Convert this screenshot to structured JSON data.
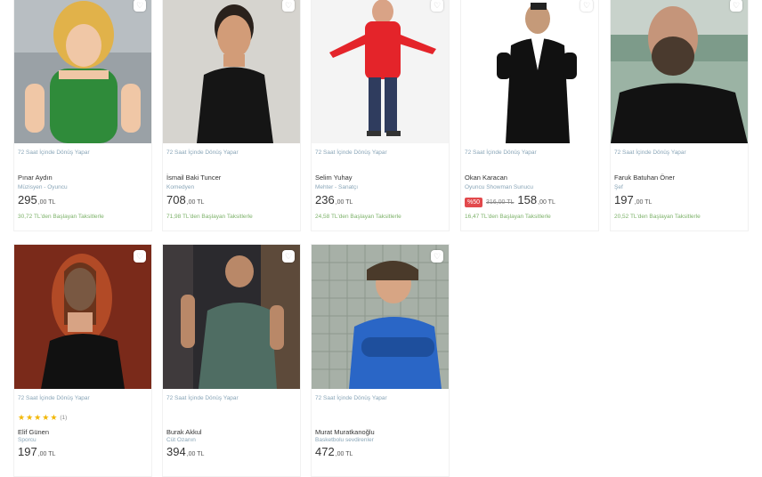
{
  "cards": [
    {
      "delivery": "72 Saat İçinde Dönüş Yapar",
      "name": "Pınar Aydın",
      "role": "Müzisyen - Oyuncu",
      "price": "295",
      "price_dec": ",00 TL",
      "install": "30,72 TL'den Başlayan Taksitlerle"
    },
    {
      "delivery": "72 Saat İçinde Dönüş Yapar",
      "name": "İsmail Baki Tuncer",
      "role": "Komedyen",
      "price": "708",
      "price_dec": ",00 TL",
      "install": "71,98 TL'den Başlayan Taksitlerle"
    },
    {
      "delivery": "72 Saat İçinde Dönüş Yapar",
      "name": "Selim Yuhay",
      "role": "Mehter - Sanatçı",
      "price": "236",
      "price_dec": ",00 TL",
      "install": "24,58 TL'den Başlayan Taksitlerle"
    },
    {
      "delivery": "72 Saat İçinde Dönüş Yapar",
      "name": "Okan Karacan",
      "role": "Oyuncu Showman Sunucu",
      "discount": "%50",
      "old_price": "316,00 TL",
      "price": "158",
      "price_dec": ",00 TL",
      "install": "16,47 TL'den Başlayan Taksitlerle"
    },
    {
      "delivery": "72 Saat İçinde Dönüş Yapar",
      "name": "Faruk Batuhan Öner",
      "role": "Şef",
      "price": "197",
      "price_dec": ",00 TL",
      "install": "20,52 TL'den Başlayan Taksitlerle"
    },
    {
      "delivery": "72 Saat İçinde Dönüş Yapar",
      "name": "Elif Günen",
      "role": "Sporcu",
      "rating_count": "(1)",
      "price": "197",
      "price_dec": ",00 TL"
    },
    {
      "delivery": "72 Saat İçinde Dönüş Yapar",
      "name": "Burak Akkul",
      "role": "Cüt Ozanın",
      "price": "394",
      "price_dec": ",00 TL"
    },
    {
      "delivery": "72 Saat İçinde Dönüş Yapar",
      "name": "Murat Muratkanoğlu",
      "role": "Basketbolu sevdirenler",
      "price": "472",
      "price_dec": ",00 TL"
    }
  ],
  "icons": {
    "favorite": "heart-icon",
    "rating": "star-icon"
  },
  "colors": {
    "discount": "#e2494c",
    "installment": "#7db26a",
    "star": "#f2b705"
  },
  "rating_stars": 5
}
